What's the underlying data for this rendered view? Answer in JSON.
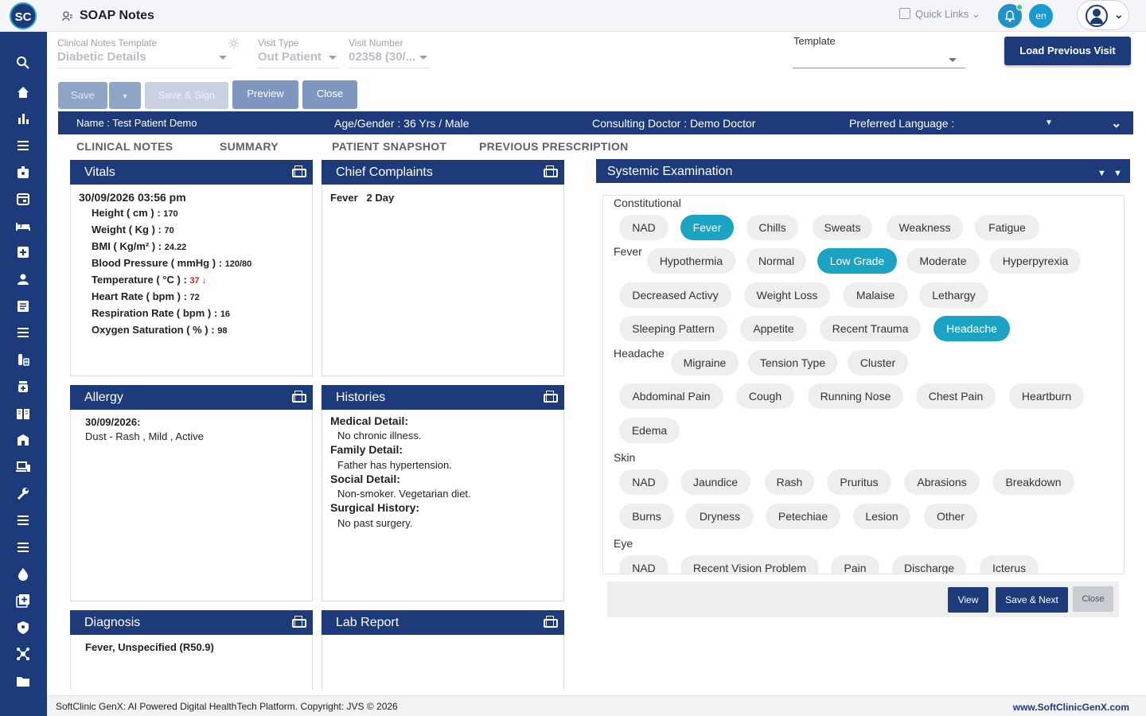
{
  "app": {
    "logo_text": "SC",
    "title": "SOAP Notes"
  },
  "topbar": {
    "quick_links": "Quick Links",
    "lang": "en"
  },
  "form": {
    "clinical_template_label": "Clinical Notes Template",
    "clinical_template_value": "Diabetic Details",
    "visit_type_label": "Visit Type",
    "visit_type_value": "Out Patient",
    "visit_number_label": "Visit Number",
    "visit_number_value": "02358 (30/...",
    "template_label": "Template",
    "load_previous": "Load Previous Visit"
  },
  "toolbar": {
    "save": "Save",
    "save_sign": "Save & Sign",
    "preview": "Preview",
    "close": "Close"
  },
  "patient": {
    "name": "Name :  Test Patient Demo",
    "age_gender": "Age/Gender :  36 Yrs / Male",
    "doctor": "Consulting Doctor :  Demo Doctor",
    "language": "Preferred Language :"
  },
  "tabs": [
    "CLINICAL NOTES",
    "SUMMARY",
    "PATIENT SNAPSHOT",
    "PREVIOUS PRESCRIPTION"
  ],
  "vitals": {
    "title": "Vitals",
    "date": "30/09/2026 03:56 pm",
    "rows": [
      {
        "label": "Height ( cm ) :",
        "value": "170"
      },
      {
        "label": "Weight ( Kg ) :",
        "value": "70"
      },
      {
        "label": "BMI ( Kg/m² ) :",
        "value": "24.22"
      },
      {
        "label": "Blood Pressure ( mmHg ) :",
        "value": "120/80"
      },
      {
        "label": "Temperature ( °C ) :",
        "value": "37 ↓"
      },
      {
        "label": "Heart Rate ( bpm ) :",
        "value": "72"
      },
      {
        "label": "Respiration Rate ( bpm ) :",
        "value": "16"
      },
      {
        "label": "Oxygen Saturation ( % ) :",
        "value": "98"
      }
    ]
  },
  "chief_complaints": {
    "title": "Chief Complaints",
    "text": "Fever   2 Day"
  },
  "allergy": {
    "title": "Allergy",
    "date": "30/09/2026:",
    "text": "Dust - Rash , Mild , Active"
  },
  "histories": {
    "title": "Histories",
    "items": [
      {
        "heading": "Medical Detail:",
        "text": "No chronic illness."
      },
      {
        "heading": "Family Detail:",
        "text": "Father has hypertension."
      },
      {
        "heading": "Social Detail:",
        "text": "Non-smoker. Vegetarian diet."
      },
      {
        "heading": "Surgical History:",
        "text": "No past surgery."
      }
    ]
  },
  "diagnosis": {
    "title": "Diagnosis",
    "text": "Fever, Unspecified (R50.9)"
  },
  "lab_report": {
    "title": "Lab Report"
  },
  "systemic": {
    "title": "Systemic Examination",
    "groups": {
      "constitutional": "Constitutional",
      "fever": "Fever",
      "headache": "Headache",
      "skin": "Skin",
      "eye": "Eye"
    },
    "constitutional_chips": [
      "NAD",
      "Fever",
      "Chills",
      "Sweats",
      "Weakness",
      "Fatigue"
    ],
    "fever_chips": [
      "Hypothermia",
      "Normal",
      "Low Grade",
      "Moderate",
      "Hyperpyrexia"
    ],
    "general_chips": [
      "Decreased Activy",
      "Weight Loss",
      "Malaise",
      "Lethargy",
      "Sleeping Pattern",
      "Appetite",
      "Recent Trauma",
      "Headache"
    ],
    "headache_chips": [
      "Migraine",
      "Tension Type",
      "Cluster"
    ],
    "other_chips": [
      "Abdominal Pain",
      "Cough",
      "Running Nose",
      "Chest Pain",
      "Heartburn",
      "Edema"
    ],
    "skin_chips": [
      "NAD",
      "Jaundice",
      "Rash",
      "Pruritus",
      "Abrasions",
      "Breakdown",
      "Burns",
      "Dryness",
      "Petechiae",
      "Lesion",
      "Other"
    ],
    "eye_chips": [
      "NAD",
      "Recent Vision Problem",
      "Pain",
      "Discharge",
      "Icterus"
    ],
    "selected": [
      "Fever",
      "Low Grade",
      "Headache"
    ]
  },
  "actions": {
    "view": "View",
    "save_next": "Save & Next",
    "close": "Close"
  },
  "footer": {
    "text": "SoftClinic GenX: AI Powered Digital HealthTech Platform. Copyright: JVS © 2026",
    "url": "www.SoftClinicGenX.com"
  },
  "colors": {
    "primary": "#1d3a7a",
    "accent": "#1aa3c3",
    "chip": "#eeeeee",
    "alert": "#d21f1f"
  }
}
